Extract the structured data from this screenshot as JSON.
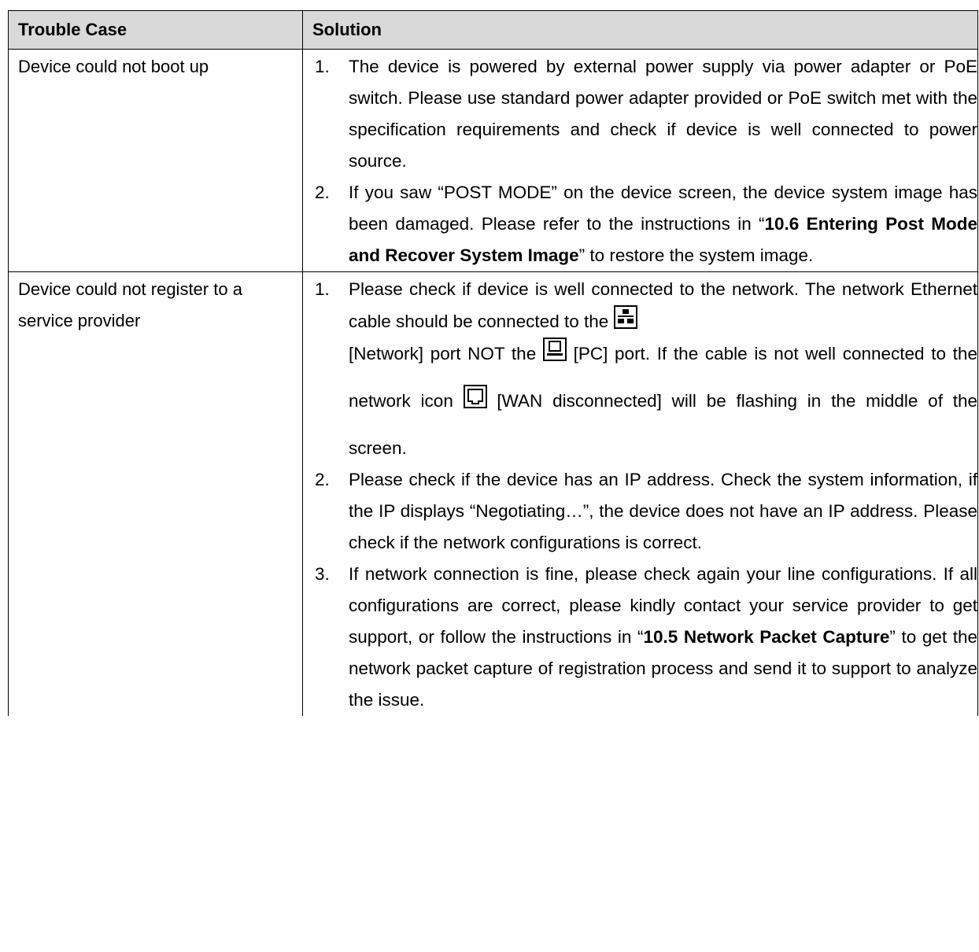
{
  "header": {
    "col1": "Trouble Case",
    "col2": "Solution"
  },
  "rows": [
    {
      "case": "Device could not boot up",
      "items": [
        {
          "num": "1.",
          "text": "The device is powered by external power supply via power adapter or PoE switch. Please use standard power adapter provided or PoE switch met with the specification requirements and check if device is well connected to power source."
        },
        {
          "num": "2.",
          "pre": "If you saw “POST MODE” on the device screen, the device system image has been damaged. Please refer to the instructions in “",
          "bold": "10.6 Entering Post Mode and Recover System Image",
          "post": "” to restore the system image."
        }
      ]
    },
    {
      "case": "Device could not register to a service provider",
      "items": [
        {
          "num": "1.",
          "part1": "Please check if device is well connected to the network. The network Ethernet cable should be connected to the",
          "part2": "[Network] port NOT the",
          "part3": "[PC] port. If the cable is not well connected to the network icon",
          "part4": "[WAN disconnected] will be flashing in the middle of the screen.",
          "icons": [
            "network-port-icon",
            "pc-port-icon",
            "wan-disconnected-icon"
          ]
        },
        {
          "num": "2.",
          "text": "Please check if the device has an IP address. Check the system information, if the IP displays “Negotiating…”, the device does not have an IP address. Please check if the network configurations is correct."
        },
        {
          "num": "3.",
          "pre": "If network connection is fine, please check again your line configurations. If all configurations are correct, please kindly contact your service provider to get support, or follow the instructions in “",
          "bold": "10.5 Network Packet Capture",
          "post": "” to get the network packet capture of registration process and send it to support to analyze the issue."
        }
      ]
    }
  ],
  "colors": {
    "header_bg": "#d9d9d9",
    "border": "#000000",
    "text": "#000000"
  }
}
